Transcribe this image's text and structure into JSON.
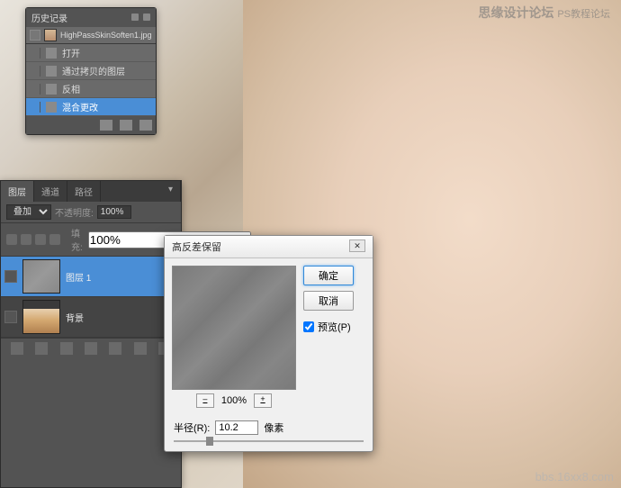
{
  "watermark": {
    "top_main": "思缘设计论坛",
    "top_sub": "PS教程论坛",
    "bottom": "bbs.16xx8.com"
  },
  "history": {
    "title": "历史记录",
    "filename": "HighPassSkinSoften1.jpg",
    "items": [
      {
        "label": "打开"
      },
      {
        "label": "通过拷贝的图层"
      },
      {
        "label": "反相"
      },
      {
        "label": "混合更改"
      }
    ],
    "selected_index": 3
  },
  "layers": {
    "tabs": [
      "图层",
      "通道",
      "路径"
    ],
    "active_tab": 0,
    "blend_mode": "叠加",
    "opacity_label": "不透明度:",
    "opacity_value": "100%",
    "fill_label": "填充:",
    "fill_value": "100%",
    "rows": [
      {
        "name": "图层 1",
        "selected": true,
        "thumb": "gray"
      },
      {
        "name": "背景",
        "selected": false,
        "thumb": "photo",
        "locked": true
      }
    ],
    "selected_index": 0
  },
  "highpass": {
    "title": "高反差保留",
    "ok": "确定",
    "cancel": "取消",
    "preview_label": "预览(P)",
    "preview_checked": true,
    "zoom": "100%",
    "radius_label": "半径(R):",
    "radius_value": "10.2",
    "unit": "像素"
  }
}
